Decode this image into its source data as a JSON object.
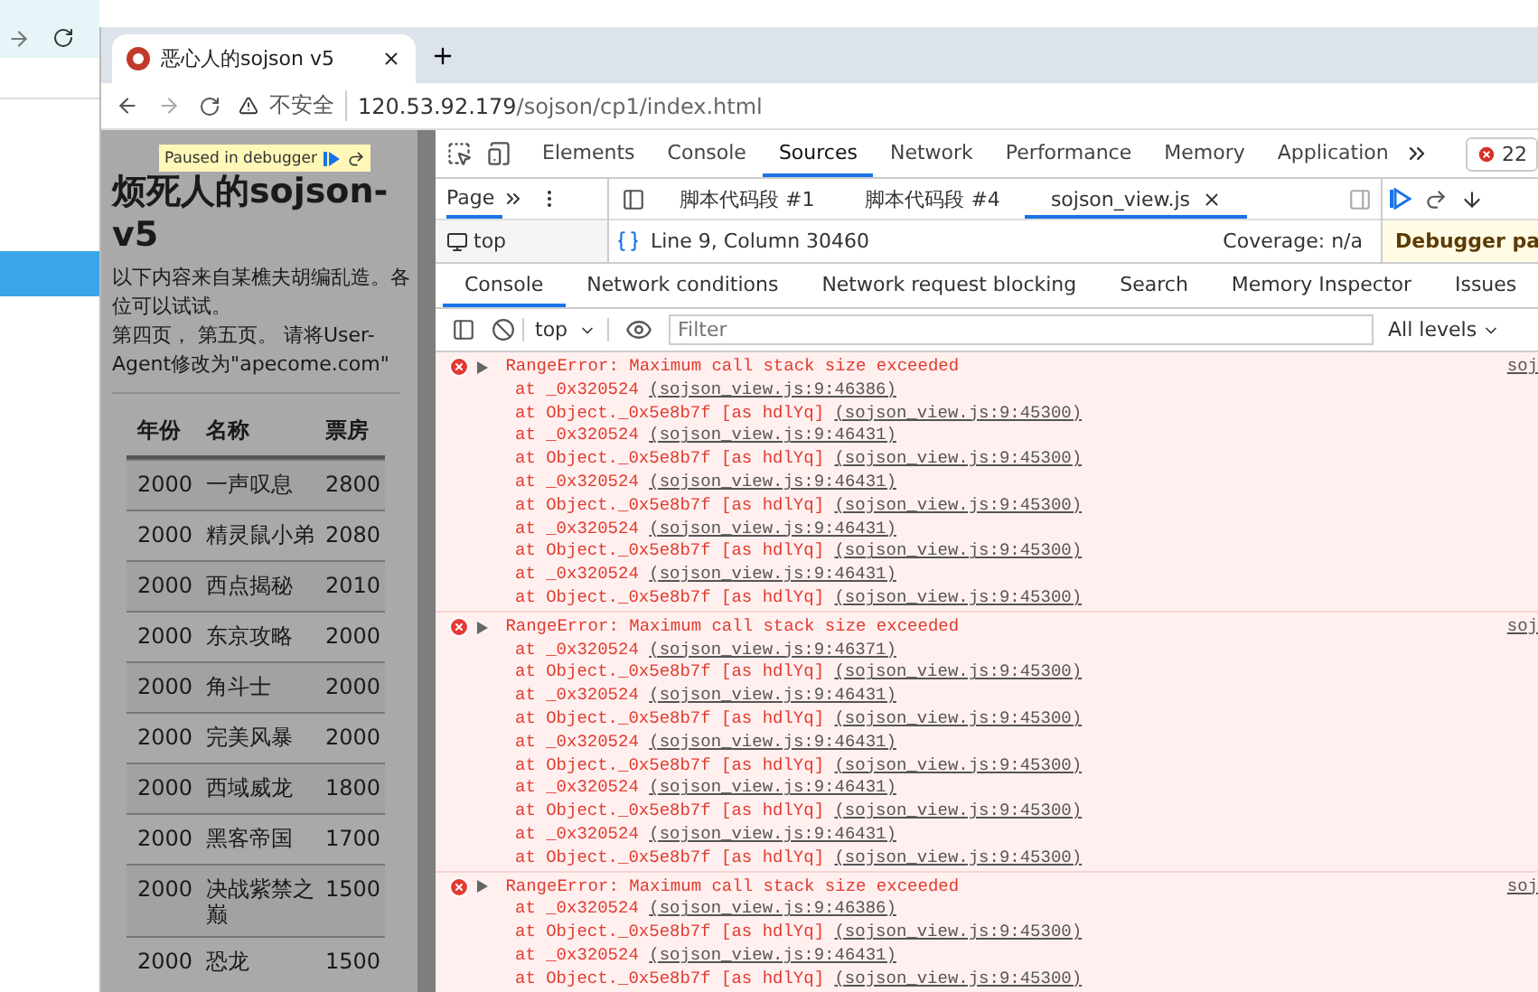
{
  "browser": {
    "tab": {
      "title": "恶心人的sojson v5",
      "selected": true
    },
    "address": {
      "security": "不安全",
      "url_host": "120.53.92.179",
      "url_path": "/sojson/cp1/index.html"
    }
  },
  "page": {
    "paused_banner": "Paused in debugger",
    "heading": "烦死人的sojson-v5",
    "paragraphs": [
      "以下内容来自某樵夫胡编乱造。各位可以试试。",
      "第四页， 第五页。 请将User-Agent修改为\"apecome.com\""
    ],
    "table": {
      "columns": [
        "年份",
        "名称",
        "票房"
      ],
      "rows": [
        [
          "2000",
          "一声叹息",
          "2800"
        ],
        [
          "2000",
          "精灵鼠小弟",
          "2080"
        ],
        [
          "2000",
          "西点揭秘",
          "2010"
        ],
        [
          "2000",
          "东京攻略",
          "2000"
        ],
        [
          "2000",
          "角斗士",
          "2000"
        ],
        [
          "2000",
          "完美风暴",
          "2000"
        ],
        [
          "2000",
          "西域威龙",
          "1800"
        ],
        [
          "2000",
          "黑客帝国",
          "1700"
        ],
        [
          "2000",
          "决战紫禁之巅",
          "1500"
        ],
        [
          "2000",
          "恐龙",
          "1500"
        ]
      ]
    }
  },
  "devtools": {
    "tabs": [
      {
        "label": "Elements",
        "selected": false
      },
      {
        "label": "Console",
        "selected": false
      },
      {
        "label": "Sources",
        "selected": true
      },
      {
        "label": "Network",
        "selected": false
      },
      {
        "label": "Performance",
        "selected": false
      },
      {
        "label": "Memory",
        "selected": false
      },
      {
        "label": "Application",
        "selected": false
      }
    ],
    "error_count": "22",
    "navigator": {
      "tab": "Page",
      "tree_item": "top"
    },
    "editor_tabs": [
      {
        "label": "脚本代码段 #1",
        "selected": false,
        "closable": false
      },
      {
        "label": "脚本代码段 #4",
        "selected": false,
        "closable": false
      },
      {
        "label": "sojson_view.js",
        "selected": true,
        "closable": true
      }
    ],
    "status": {
      "position": "Line 9, Column 30460",
      "coverage": "Coverage: n/a"
    },
    "debugger_banner": "Debugger pa",
    "drawer_tabs": [
      {
        "label": "Console",
        "selected": true
      },
      {
        "label": "Network conditions",
        "selected": false
      },
      {
        "label": "Network request blocking",
        "selected": false
      },
      {
        "label": "Search",
        "selected": false
      },
      {
        "label": "Memory Inspector",
        "selected": false
      },
      {
        "label": "Issues",
        "selected": false
      }
    ],
    "console_toolbar": {
      "context": "top",
      "filter_placeholder": "Filter",
      "levels": "All levels"
    },
    "messages": [
      {
        "text": "RangeError: Maximum call stack size exceeded",
        "source": "soj",
        "frames": [
          {
            "func": "at _0x320524",
            "location": "(sojson_view.js:9:46386)"
          },
          {
            "func": "at Object._0x5e8b7f [as hdlYq]",
            "location": "(sojson_view.js:9:45300)"
          },
          {
            "func": "at _0x320524",
            "location": "(sojson_view.js:9:46431)"
          },
          {
            "func": "at Object._0x5e8b7f [as hdlYq]",
            "location": "(sojson_view.js:9:45300)"
          },
          {
            "func": "at _0x320524",
            "location": "(sojson_view.js:9:46431)"
          },
          {
            "func": "at Object._0x5e8b7f [as hdlYq]",
            "location": "(sojson_view.js:9:45300)"
          },
          {
            "func": "at _0x320524",
            "location": "(sojson_view.js:9:46431)"
          },
          {
            "func": "at Object._0x5e8b7f [as hdlYq]",
            "location": "(sojson_view.js:9:45300)"
          },
          {
            "func": "at _0x320524",
            "location": "(sojson_view.js:9:46431)"
          },
          {
            "func": "at Object._0x5e8b7f [as hdlYq]",
            "location": "(sojson_view.js:9:45300)"
          }
        ]
      },
      {
        "text": "RangeError: Maximum call stack size exceeded",
        "source": "soj",
        "frames": [
          {
            "func": "at _0x320524",
            "location": "(sojson_view.js:9:46371)"
          },
          {
            "func": "at Object._0x5e8b7f [as hdlYq]",
            "location": "(sojson_view.js:9:45300)"
          },
          {
            "func": "at _0x320524",
            "location": "(sojson_view.js:9:46431)"
          },
          {
            "func": "at Object._0x5e8b7f [as hdlYq]",
            "location": "(sojson_view.js:9:45300)"
          },
          {
            "func": "at _0x320524",
            "location": "(sojson_view.js:9:46431)"
          },
          {
            "func": "at Object._0x5e8b7f [as hdlYq]",
            "location": "(sojson_view.js:9:45300)"
          },
          {
            "func": "at _0x320524",
            "location": "(sojson_view.js:9:46431)"
          },
          {
            "func": "at Object._0x5e8b7f [as hdlYq]",
            "location": "(sojson_view.js:9:45300)"
          },
          {
            "func": "at _0x320524",
            "location": "(sojson_view.js:9:46431)"
          },
          {
            "func": "at Object._0x5e8b7f [as hdlYq]",
            "location": "(sojson_view.js:9:45300)"
          }
        ]
      },
      {
        "text": "RangeError: Maximum call stack size exceeded",
        "source": "soj",
        "frames": [
          {
            "func": "at _0x320524",
            "location": "(sojson_view.js:9:46386)"
          },
          {
            "func": "at Object._0x5e8b7f [as hdlYq]",
            "location": "(sojson_view.js:9:45300)"
          },
          {
            "func": "at _0x320524",
            "location": "(sojson_view.js:9:46431)"
          },
          {
            "func": "at Object._0x5e8b7f [as hdlYq]",
            "location": "(sojson_view.js:9:45300)"
          }
        ]
      }
    ]
  }
}
